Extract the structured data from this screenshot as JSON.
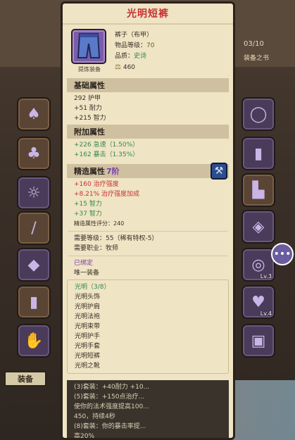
{
  "background": {
    "top_left_label": "",
    "right_label_1": "03/10",
    "right_label_2": "装备之书",
    "equip_tab": "装备",
    "left_slots": [
      "cape",
      "cape",
      "belt",
      "helm",
      "staff",
      "pants",
      "glove",
      "shield"
    ],
    "right_slots": [
      {
        "glyph": "ring",
        "level": ""
      },
      {
        "glyph": "pants",
        "level": ""
      },
      {
        "glyph": "boots",
        "level": ""
      },
      {
        "glyph": "bracer",
        "level": ""
      },
      {
        "glyph": "ring",
        "level": "Lv.3"
      },
      {
        "glyph": "ring",
        "level": ""
      },
      {
        "glyph": "necklace",
        "level": "Lv.4"
      },
      {
        "glyph": "book",
        "level": ""
      }
    ],
    "chat_icon": "chat-bubble-icon"
  },
  "item": {
    "title": "光明短裤",
    "type_label": "裤子（布甲）",
    "level_label": "物品等级：",
    "level_value": "70",
    "quality_label": "品质：",
    "quality_value": "史诗",
    "price": "460",
    "sub_label": "提炼装备"
  },
  "base": {
    "header": "基础属性",
    "lines": [
      "292 护甲",
      "+51 耐力",
      "+215 智力"
    ]
  },
  "extra": {
    "header": "附加属性",
    "lines": [
      "+226 急速（1.50%）",
      "+162 暴击（1.35%）"
    ]
  },
  "refine": {
    "header": "精造属性",
    "level": "7阶",
    "red_lines": [
      "+160 治疗强度",
      "+8.21% 治疗强度加成"
    ],
    "green_lines": [
      "+15 智力",
      "+37 智力"
    ],
    "score": "精造属性评分：240"
  },
  "requirements": {
    "level": "需要等级：55（稀有特权-5）",
    "class": "需要职业：牧师",
    "bound": "已绑定",
    "unique": "唯一装备"
  },
  "set": {
    "name": "光明（3/8）",
    "pieces": [
      "光明头饰",
      "光明护肩",
      "光明法袍",
      "光明束带",
      "光明护手",
      "光明手套",
      "光明短裤",
      "光明之靴"
    ]
  },
  "set_bonus": {
    "lines": [
      "(3)套装：+40耐力 +10...",
      "(5)套装：+150点治疗...",
      "使你的法术强度提高100...",
      "450，持续4秒",
      "(8)套装：你的暴击率提...",
      "高20%"
    ]
  }
}
